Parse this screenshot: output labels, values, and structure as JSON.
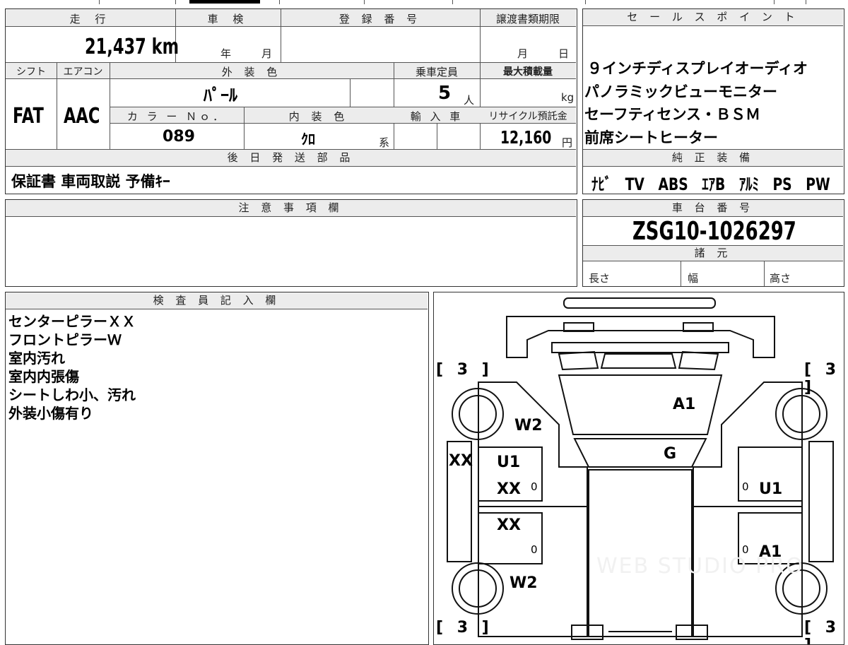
{
  "main": {
    "mileage_label": "走 行",
    "mileage_value": "21,437 km",
    "inspection_label": "車 検",
    "inspection_year": "年",
    "inspection_month": "月",
    "registration_label": "登 録 番 号",
    "deadline_label": "譲渡書類期限",
    "deadline_month": "月",
    "deadline_day": "日",
    "shift_label": "シフト",
    "shift_value": "FAT",
    "aircon_label": "エアコン",
    "aircon_value": "AAC",
    "exterior_label": "外 装 色",
    "exterior_value": "ﾊﾟｰﾙ",
    "capacity_label": "乗車定員",
    "capacity_value": "5",
    "capacity_unit": "人",
    "loadcap_label": "最大積載量",
    "loadcap_unit": "kg",
    "color_no_label": "カ ラ ー Ｎｏ．",
    "color_no_value": "089",
    "interior_label": "内 装 色",
    "interior_value": "ｸﾛ",
    "interior_suffix": "系",
    "import_label": "輸 入 車",
    "recycle_label": "リサイクル預託金",
    "recycle_value": "12,160",
    "recycle_unit": "円",
    "later_label": "後 日 発 送 部 品",
    "later_value": "保証書 車両取説 予備ｷｰ"
  },
  "sales": {
    "label": "セ ー ル ス ポ イ ン ト",
    "points": [
      "９インチディスプレイオーディオ",
      "パノラミックビューモニター",
      "セーフティセンス・ＢＳＭ",
      "前席シートヒーター"
    ],
    "equip_label": "純 正 装 備",
    "equip_items": [
      "ﾅﾋﾞ",
      "TV",
      "ABS",
      "ｴｱB",
      "ｱﾙﾐ",
      "PS",
      "PW"
    ]
  },
  "caution": {
    "label": "注 意 事 項 欄"
  },
  "chassis": {
    "label": "車 台 番 号",
    "value": "ZSG10-1026297",
    "spec_label": "諸 元",
    "length_label": "長さ",
    "width_label": "幅",
    "height_label": "高さ"
  },
  "inspector": {
    "label": "検 査 員 記 入 欄",
    "notes": [
      "センターピラーＸＸ",
      "フロントピラーＷ",
      "室内汚れ",
      "室内内張傷",
      "シートしわ小、汚れ",
      "外装小傷有り"
    ]
  },
  "diagram": {
    "brackets": [
      "[ 3 ]",
      "[ 3 ]",
      "[ 3 ]",
      "[ 3 ]"
    ],
    "marks": {
      "a1_top": "A1",
      "w2_front": "W2",
      "g": "G",
      "xx_side": "XX",
      "u1_left": "U1",
      "xx_left_front": "XX",
      "zero_lf": "0",
      "zero_rf": "0",
      "u1_right": "U1",
      "xx_left_rear": "XX",
      "zero_lr": "0",
      "zero_rr": "0",
      "a1_right": "A1",
      "w2_rear": "W2"
    },
    "watermark": "WEB STUDIO PRO"
  }
}
